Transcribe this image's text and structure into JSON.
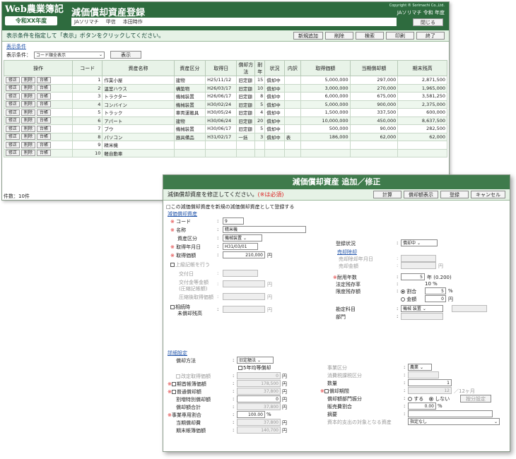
{
  "header": {
    "logo_line1": "Web農業簿記",
    "logo_line2": "令和XX年度",
    "title": "減価償却資産登録",
    "sub_items": [
      "JAソリマチ",
      "甲信",
      "本田時作"
    ],
    "copyright": "Copyright ® Sorimachi Co.,Ltd.",
    "user": "JAソリマチ 令和 年度",
    "close_label": "閉じる"
  },
  "toolbar": {
    "message": "表示条件を指定して「表示」ボタンをクリックしてください。",
    "buttons": [
      "新規追加",
      "削除",
      "検索",
      "印刷",
      "終了"
    ]
  },
  "conditions": {
    "link": "表示条件",
    "label": "表示条件：",
    "select_value": "コード順全表示",
    "show_button": "表示"
  },
  "table": {
    "headers": [
      "操作",
      "コード",
      "資産名称",
      "資産区分",
      "取得日",
      "償却方法",
      "耐年",
      "状況",
      "内訳",
      "取得価額",
      "当期償却額",
      "期末残高"
    ],
    "row_buttons": [
      "修正",
      "削除",
      "台帳"
    ],
    "rows": [
      [
        "1",
        "作業小屋",
        "建物",
        "H25/11/12",
        "旧定額",
        "15",
        "償却中",
        "",
        "5,000,000",
        "297,000",
        "2,871,500"
      ],
      [
        "2",
        "温室ハウス",
        "構築物",
        "H26/03/17",
        "旧定額",
        "10",
        "償却中",
        "",
        "3,000,000",
        "270,000",
        "1,965,000"
      ],
      [
        "3",
        "トラクター",
        "機械装置",
        "H26/06/17",
        "旧定額",
        "8",
        "償却中",
        "",
        "6,000,000",
        "675,000",
        "3,581,250"
      ],
      [
        "4",
        "コンバイン",
        "機械装置",
        "H30/02/24",
        "旧定額",
        "5",
        "償却中",
        "",
        "5,000,000",
        "900,000",
        "2,375,000"
      ],
      [
        "5",
        "トラック",
        "車両運搬具",
        "H30/05/24",
        "旧定額",
        "4",
        "償却中",
        "",
        "1,500,000",
        "337,500",
        "600,000"
      ],
      [
        "6",
        "アパート",
        "建物",
        "H30/06/24",
        "旧定額",
        "20",
        "償却中",
        "",
        "10,000,000",
        "450,000",
        "8,637,500"
      ],
      [
        "7",
        "ブウ",
        "機械装置",
        "H30/06/17",
        "旧定額",
        "5",
        "償却中",
        "",
        "500,000",
        "90,000",
        "282,500"
      ],
      [
        "8",
        "パソコン",
        "器具備品",
        "H31/02/17",
        "一括",
        "3",
        "償却中",
        "表",
        "186,000",
        "62,000",
        "62,000"
      ],
      [
        "9",
        "精米機",
        "",
        "",
        "",
        "",
        "",
        "",
        "",
        "",
        ""
      ],
      [
        "10",
        "軽自動車",
        "",
        "",
        "",
        "",
        "",
        "",
        "",
        "",
        ""
      ]
    ]
  },
  "footer": {
    "count": "件数：10件"
  },
  "dialog": {
    "title": "減価償却資産 追加／修正",
    "message": "減価償却資産を修正してください。",
    "required_note": "(※は必須)",
    "buttons": [
      "計算",
      "償却額表示",
      "登録",
      "キャンセル"
    ],
    "copy_checkbox": "□この減価償却資産を新規の減価償却資産として登録する",
    "section_asset": "減価償却資産",
    "code_label": "コード",
    "code_value": "9",
    "name_label": "名称",
    "name_value": "精米機",
    "category_label": "資産区分",
    "category_value": "機械装置",
    "acq_date_label": "取得年月日",
    "acq_date_value": "H31/03/01",
    "acq_price_label": "取得価額",
    "acq_price_value": "210,000",
    "yen": "円",
    "compressed_label": "上級記帳を行う",
    "grant_date_label": "交付日",
    "grant_amount_label": "交付金等金額",
    "grant_amount_sub": "(圧縮記帳額)",
    "after_price_label": "圧縮後取得価額",
    "inherit_label": "相続時",
    "inherit_label2": "未償却残高",
    "status_label": "登録状況",
    "status_value": "償却中",
    "sale_link": "売却除却",
    "sale_date_label": "売却除却年月日",
    "sale_amount_label": "売却金額",
    "life_label": "耐用年数",
    "life_value": "5",
    "life_unit": "年 (0.200)",
    "legal_residual_label": "法定残存率",
    "legal_residual_value": "10 %",
    "limit_label": "限度残存額",
    "ratio_label": "割合",
    "ratio_value": "5",
    "pct": "%",
    "amount_label": "金額",
    "amount_value": "0",
    "account_label": "勘定科目",
    "account_value": "機械 装置",
    "dept_label": "部門",
    "section_detail": "詳細設定",
    "method_label": "償却方法",
    "method_value": "旧定額法",
    "equal5_label": "5年均等償却",
    "revised_label": "改定取得価額",
    "revised_value": "0",
    "begin_book_label": "期首帳簿価額",
    "begin_book_value": "178,500",
    "normal_dep_label": "普通償却額",
    "normal_dep_value": "37,800",
    "special_dep_label": "割増特別償却額",
    "special_dep_value": "0",
    "total_dep_label": "償却額合計",
    "total_dep_value": "37,800",
    "biz_ratio_label": "事業専用割合",
    "biz_ratio_value": "100.00",
    "current_dep_label": "当期償却費",
    "current_dep_value": "37,800",
    "end_book_label": "期末帳簿価額",
    "end_book_value": "140,700",
    "biz_category_label": "事業区分",
    "biz_category_value": "農業",
    "consumption_tax_label": "消費税課税区分",
    "quantity_label": "数量",
    "quantity_value": "1",
    "period_label": "償却期間",
    "period_value": "12",
    "period_unit": "／12ヶ月",
    "dept_split_label": "償却額部門振分",
    "yes_label": "する",
    "no_label": "しない",
    "allocation_button": "按分設定",
    "sales_ratio_label": "販売費割合",
    "sales_ratio_value": "0.00",
    "summary_label": "摘要",
    "capex_label": "資本的支出の対象となる資産",
    "capex_value": "指定なし"
  }
}
